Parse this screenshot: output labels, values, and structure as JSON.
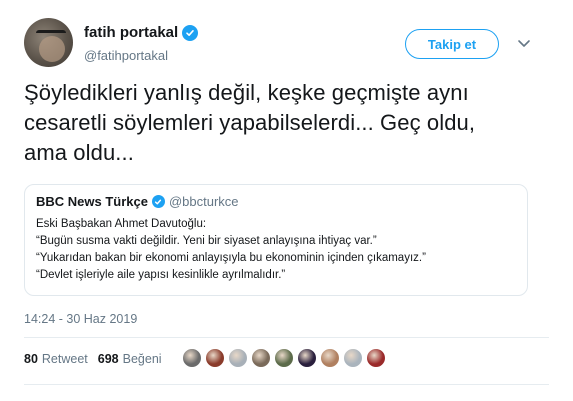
{
  "author": {
    "name": "fatih portakal",
    "handle": "@fatihportakal",
    "verified": true,
    "verified_icon": "verified-badge-icon"
  },
  "follow_button": "Takip et",
  "tweet": {
    "lines": [
      "Şöyledikleri yanlış değil, keşke geçmişte aynı",
      "cesaretli söylemleri yapabilselerdi... Geç oldu,",
      "ama oldu..."
    ]
  },
  "quoted_tweet": {
    "name": "BBC News Türkçe",
    "handle": "@bbcturkce",
    "verified": true,
    "lines": [
      "Eski Başbakan Ahmet Davutoğlu:",
      "“Bugün susma vakti değildir. Yeni bir siyaset anlayışına ihtiyaç var.”",
      "“Yukarıdan bakan bir ekonomi anlayışıyla bu ekonominin içinden çıkamayız.”",
      "“Devlet işleriyle aile yapısı kesinlikle ayrılmalıdır.”"
    ]
  },
  "timestamp": "14:24 - 30 Haz 2019",
  "stats": {
    "retweets": {
      "count": "80",
      "label": "Retweet"
    },
    "likes": {
      "count": "698",
      "label": "Beğeni"
    }
  },
  "colors": {
    "accent": "#1da1f2",
    "secondary_text": "#657786",
    "border": "#e1e8ed"
  },
  "liker_avatar_colors": [
    "#6b6b6b",
    "#8a3b2b",
    "#a8b0b8",
    "#7a6a5a",
    "#5c6b4a",
    "#2a1f3d",
    "#b08060",
    "#aab4bd",
    "#9a2a2a"
  ]
}
